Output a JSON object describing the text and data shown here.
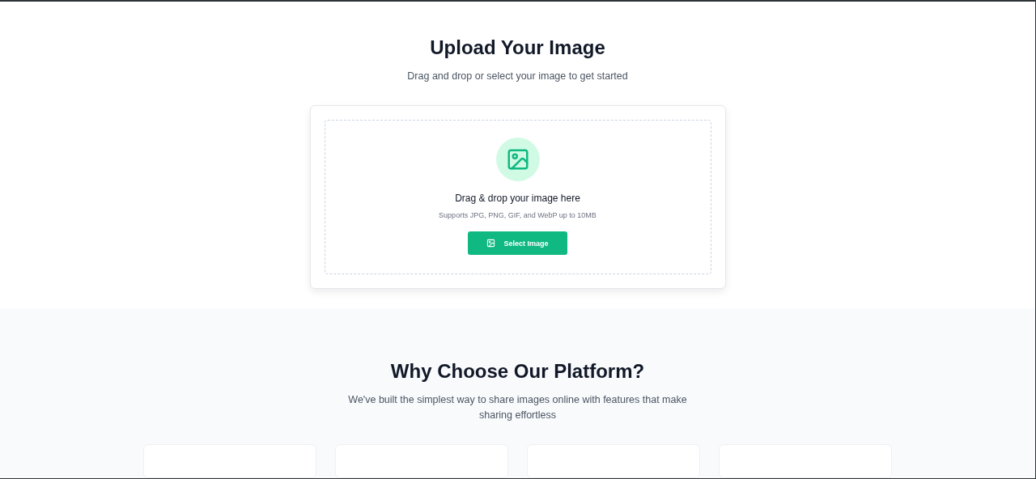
{
  "upload": {
    "title": "Upload Your Image",
    "subtitle": "Drag and drop or select your image to get started",
    "dropzone": {
      "heading": "Drag & drop your image here",
      "hint": "Supports JPG, PNG, GIF, and WebP up to 10MB",
      "button": "Select Image"
    }
  },
  "features": {
    "title": "Why Choose Our Platform?",
    "subtitle": "We've built the simplest way to share images online with features that make sharing effortless"
  }
}
